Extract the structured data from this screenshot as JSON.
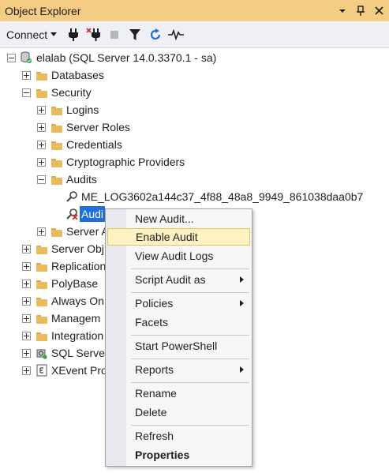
{
  "window": {
    "title": "Object Explorer",
    "controls": [
      "dropdown-icon",
      "pin-icon",
      "close-icon"
    ]
  },
  "toolbar": {
    "connect_label": "Connect",
    "buttons": [
      "connect-object-explorer-icon",
      "disconnect-icon",
      "stop-icon",
      "filter-icon",
      "refresh-icon",
      "activity-monitor-icon"
    ]
  },
  "tree": {
    "server": "elalab (SQL Server 14.0.3370.1 - sa)",
    "databases": "Databases",
    "security": "Security",
    "logins": "Logins",
    "server_roles": "Server Roles",
    "credentials": "Credentials",
    "crypto": "Cryptographic Providers",
    "audits": "Audits",
    "audit1": "ME_LOG3602a144c37_4f88_48a8_9949_861038daa0b7",
    "audit2": "Audi",
    "server_audit": "Server A",
    "server_objects": "Server Obj",
    "replication": "Replication",
    "polybase": "PolyBase",
    "always_on": "Always On",
    "management": "Managem",
    "integration": "Integration",
    "sql_agent": "SQL Server",
    "xevent": "XEvent Pro"
  },
  "context_menu": {
    "new_audit": "New Audit...",
    "enable_audit": "Enable Audit",
    "view_audit_logs": "View Audit Logs",
    "script_audit_as": "Script Audit as",
    "policies": "Policies",
    "facets": "Facets",
    "start_powershell": "Start PowerShell",
    "reports": "Reports",
    "rename": "Rename",
    "delete": "Delete",
    "refresh": "Refresh",
    "properties": "Properties"
  },
  "colors": {
    "title_bar": "#f5cc84",
    "selection": "#1e6fd9",
    "menu_highlight": "#fff2c2",
    "folder": "#e8bb5c"
  }
}
